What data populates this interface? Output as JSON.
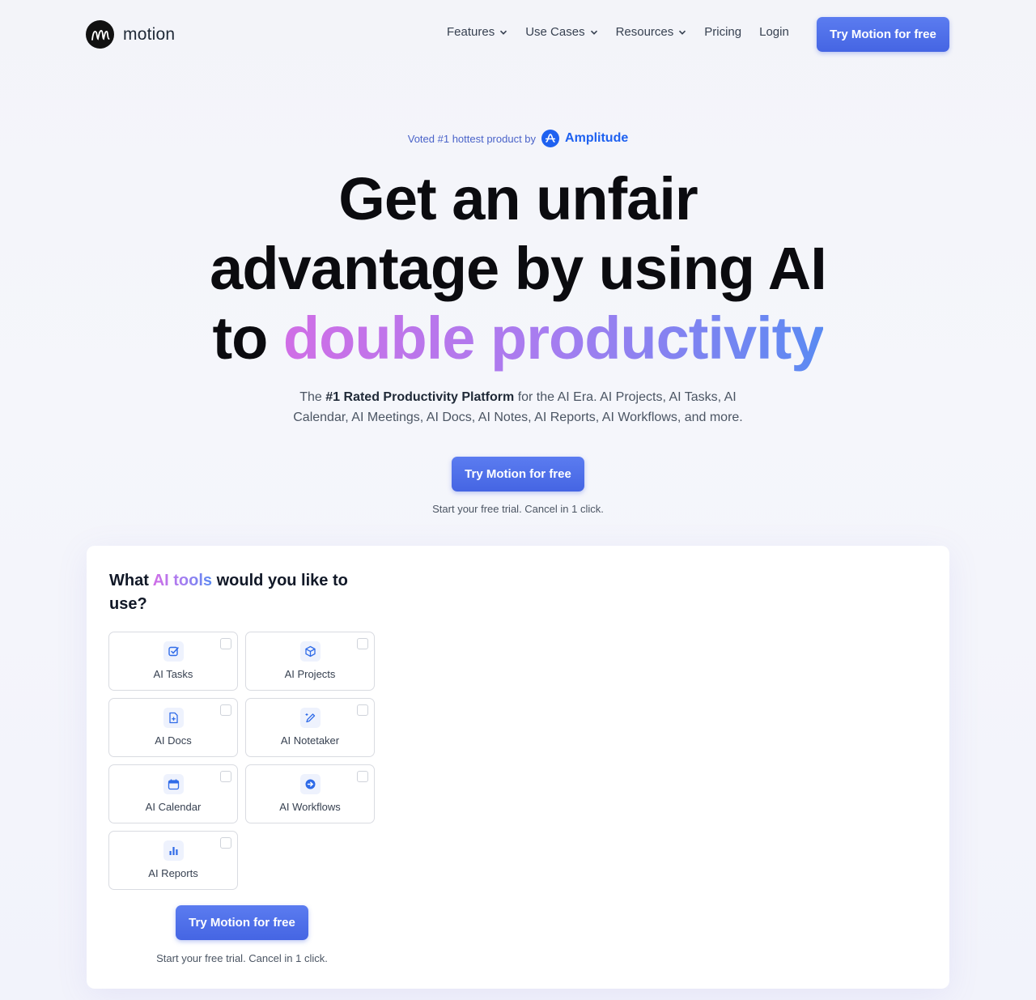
{
  "brand": {
    "name": "motion",
    "logo_icon": "motion-m-logo"
  },
  "nav": {
    "items": [
      {
        "label": "Features",
        "dropdown": true
      },
      {
        "label": "Use Cases",
        "dropdown": true
      },
      {
        "label": "Resources",
        "dropdown": true
      },
      {
        "label": "Pricing",
        "dropdown": false
      },
      {
        "label": "Login",
        "dropdown": false
      }
    ],
    "cta": "Try Motion for free"
  },
  "hero": {
    "badge_text": "Voted #1 hottest product by",
    "badge_brand": "Amplitude",
    "headline_line1": "Get an unfair",
    "headline_line2": "advantage by using AI",
    "headline_line3_prefix": "to",
    "headline_line3_highlight": "double productivity",
    "sub_prefix": "The",
    "sub_bold": "#1 Rated Productivity Platform",
    "sub_rest_line1": "for the AI Era. AI Projects, AI Tasks, AI",
    "sub_line2": "Calendar, AI Meetings, AI Docs, AI Notes, AI Reports, AI Workflows, and more.",
    "cta": "Try Motion for free",
    "note": "Start your free trial. Cancel in 1 click."
  },
  "picker": {
    "title_prefix": "What",
    "title_highlight": "AI tools",
    "title_suffix": "would you like to use?",
    "tools": [
      {
        "label": "AI Tasks",
        "icon": "checkbox-icon",
        "checked": false
      },
      {
        "label": "AI Projects",
        "icon": "cube-icon",
        "checked": false
      },
      {
        "label": "AI Docs",
        "icon": "document-plus-icon",
        "checked": false
      },
      {
        "label": "AI Notetaker",
        "icon": "pen-sparkle-icon",
        "checked": false
      },
      {
        "label": "AI Calendar",
        "icon": "calendar-icon",
        "checked": false
      },
      {
        "label": "AI Workflows",
        "icon": "arrow-circle-icon",
        "checked": false
      },
      {
        "label": "AI Reports",
        "icon": "bar-chart-icon",
        "checked": false
      }
    ],
    "cta": "Try Motion for free",
    "note": "Start your free trial. Cancel in 1 click."
  },
  "colors": {
    "accent": "#4565e3",
    "icon_blue": "#2f6be8",
    "gradient_start": "#d06ee6",
    "gradient_end": "#5a8af2"
  }
}
